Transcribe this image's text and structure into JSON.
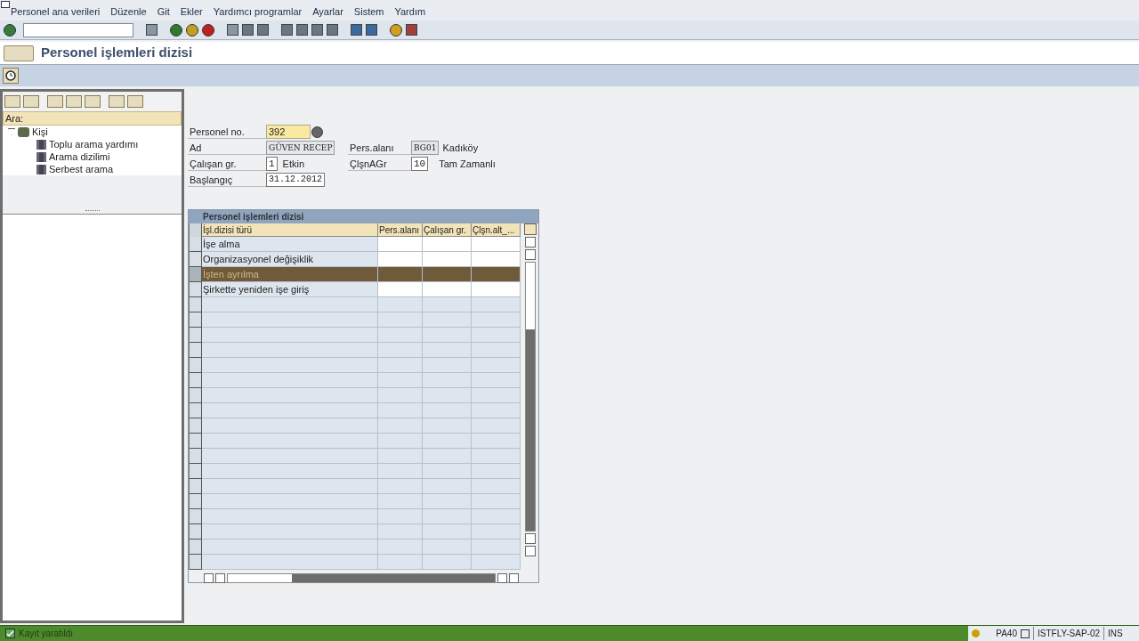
{
  "menu": [
    "Personel ana verileri",
    "Düzenle",
    "Git",
    "Ekler",
    "Yardımcı programlar",
    "Ayarlar",
    "Sistem",
    "Yardım"
  ],
  "title": "Personel işlemleri dizisi",
  "nav_panel": {
    "search_label": "Ara:",
    "tree": [
      {
        "label": "Kişi",
        "expanded": true,
        "children": [
          {
            "label": "Toplu arama yardımı"
          },
          {
            "label": "Arama dizilimi"
          },
          {
            "label": "Serbest arama"
          }
        ]
      }
    ]
  },
  "header": {
    "personnel_no": {
      "label": "Personel no.",
      "value": "392"
    },
    "name": {
      "label": "Ad",
      "value": "GÜVEN RECEP"
    },
    "pers_area": {
      "label": "Pers.alanı",
      "value": "BG01",
      "text": "Kadıköy"
    },
    "employee_group": {
      "label": "Çalışan gr.",
      "value": "1",
      "text": "Etkin"
    },
    "employee_subgroup": {
      "label": "ÇlşnAGr",
      "value": "10",
      "text": "Tam Zamanlı"
    },
    "start": {
      "label": "Başlangıç",
      "value": "31.12.2012"
    }
  },
  "table": {
    "title": "Personel işlemleri dizisi",
    "columns": [
      "İşl.dizisi türü",
      "Pers.alanı",
      "Çalışan gr.",
      "Çlşn.alt_..."
    ],
    "rows": [
      {
        "label": "İşe alma",
        "selected": false
      },
      {
        "label": "Organizasyonel değişiklik",
        "selected": false
      },
      {
        "label": "İşten ayrılma",
        "selected": true
      },
      {
        "label": "Şirkette yeniden işe giriş",
        "selected": false
      }
    ]
  },
  "status_bar": {
    "message": "Kayıt yaratıldı",
    "transaction": "PA40",
    "server": "ISTFLY-SAP-02",
    "mode": "INS"
  }
}
